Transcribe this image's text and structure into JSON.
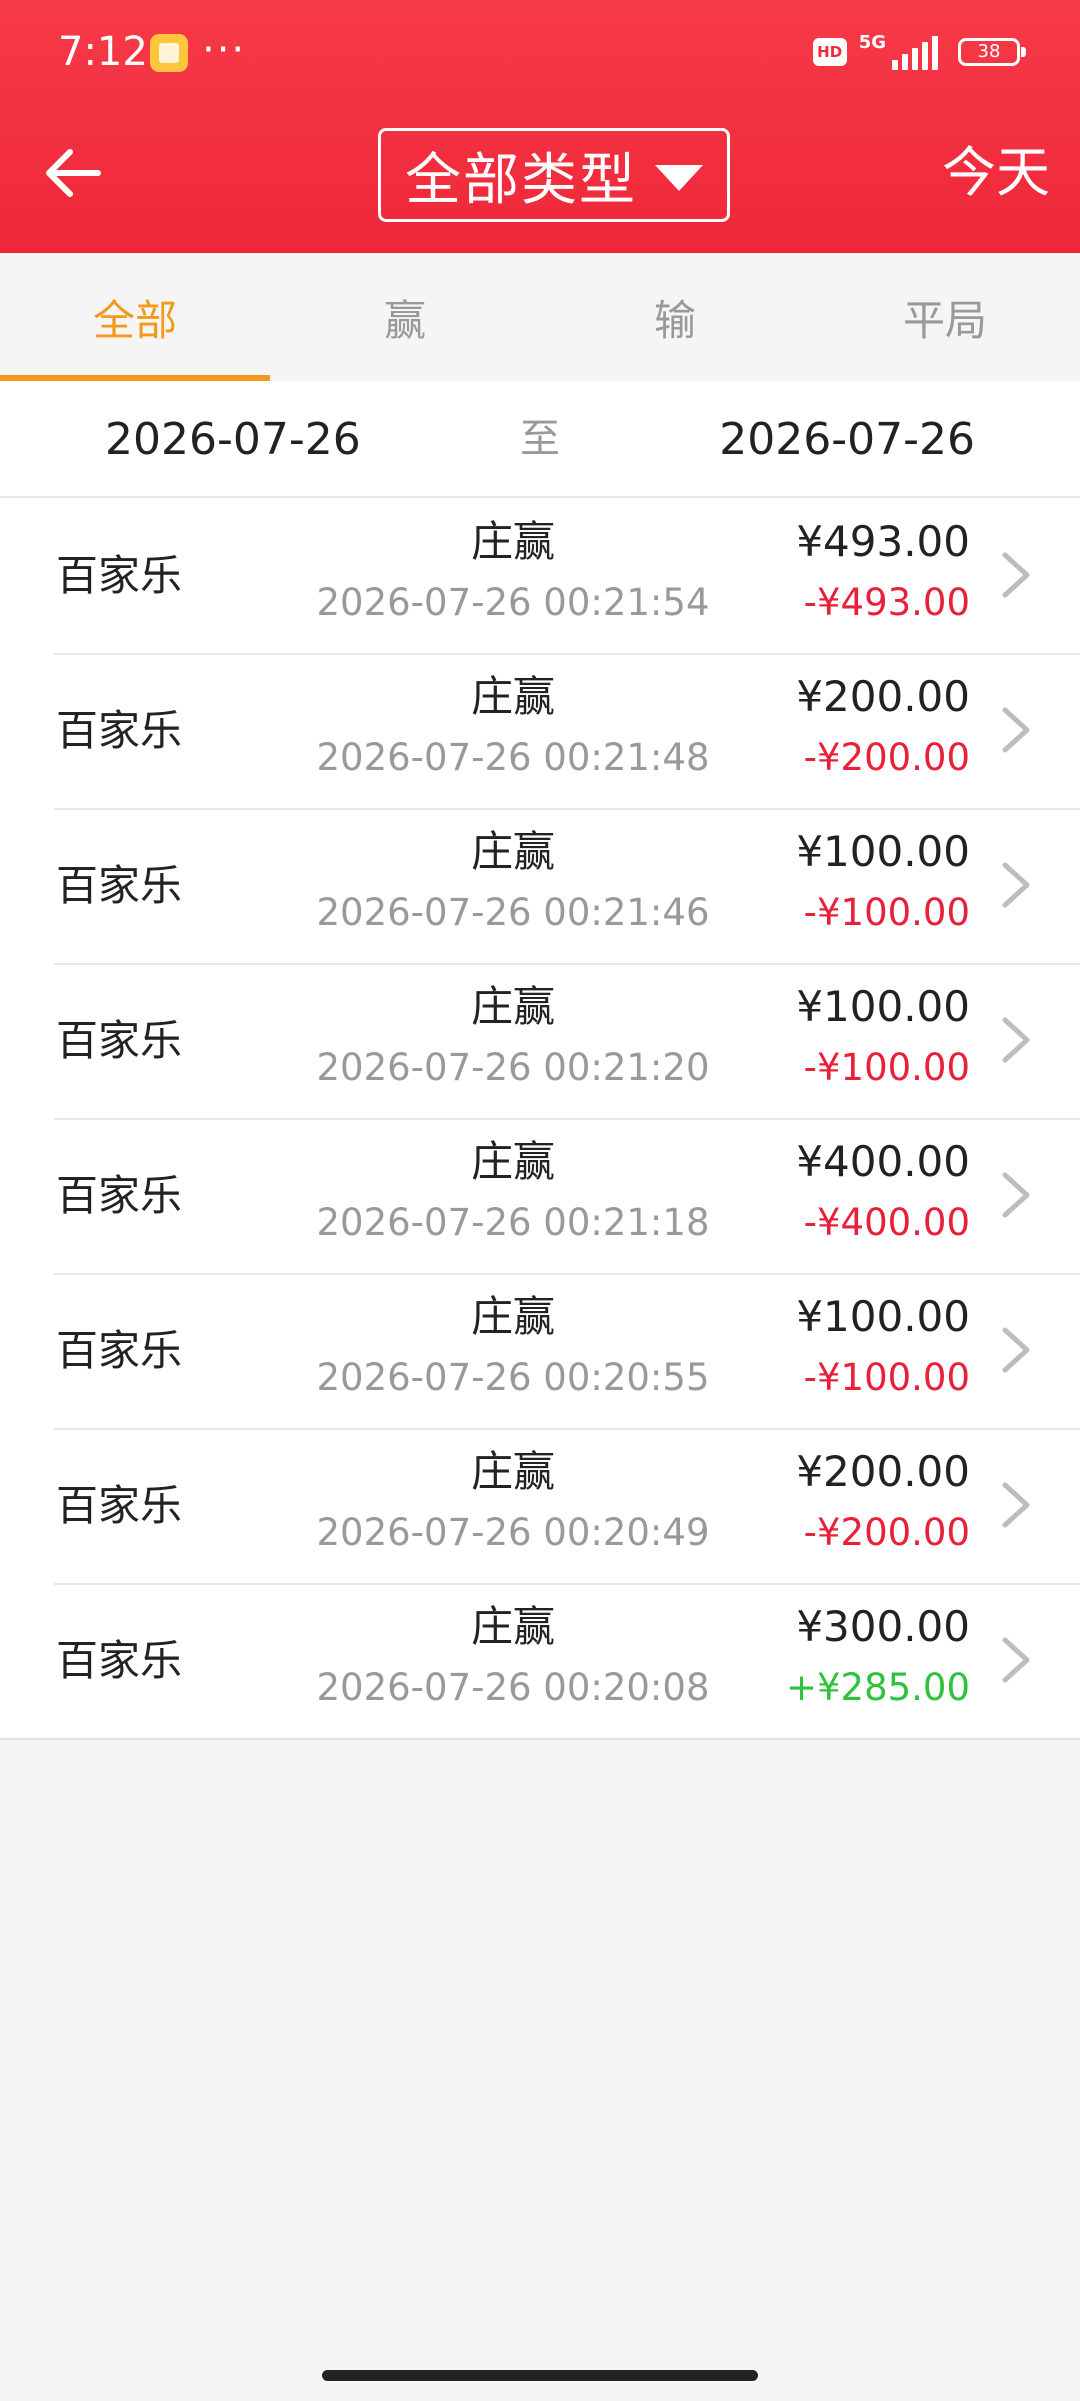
{
  "status_bar": {
    "time": "7:12",
    "dots": "···",
    "hd": "HD",
    "network": "5G",
    "battery": "38"
  },
  "header": {
    "back_icon": "arrow-left-icon",
    "title": "全部类型",
    "title_icon": "caret-down-icon",
    "today_label": "今天"
  },
  "tabs": [
    {
      "label": "全部",
      "active": true
    },
    {
      "label": "赢",
      "active": false
    },
    {
      "label": "输",
      "active": false
    },
    {
      "label": "平局",
      "active": false
    }
  ],
  "date_range": {
    "from": "2026-07-26",
    "separator": "至",
    "to": "2026-07-26"
  },
  "records": [
    {
      "game": "百家乐",
      "result": "庄赢",
      "time": "2026-07-26 00:21:54",
      "bet": "¥493.00",
      "profit": "-¥493.00",
      "profit_type": "loss"
    },
    {
      "game": "百家乐",
      "result": "庄赢",
      "time": "2026-07-26 00:21:48",
      "bet": "¥200.00",
      "profit": "-¥200.00",
      "profit_type": "loss"
    },
    {
      "game": "百家乐",
      "result": "庄赢",
      "time": "2026-07-26 00:21:46",
      "bet": "¥100.00",
      "profit": "-¥100.00",
      "profit_type": "loss"
    },
    {
      "game": "百家乐",
      "result": "庄赢",
      "time": "2026-07-26 00:21:20",
      "bet": "¥100.00",
      "profit": "-¥100.00",
      "profit_type": "loss"
    },
    {
      "game": "百家乐",
      "result": "庄赢",
      "time": "2026-07-26 00:21:18",
      "bet": "¥400.00",
      "profit": "-¥400.00",
      "profit_type": "loss"
    },
    {
      "game": "百家乐",
      "result": "庄赢",
      "time": "2026-07-26 00:20:55",
      "bet": "¥100.00",
      "profit": "-¥100.00",
      "profit_type": "loss"
    },
    {
      "game": "百家乐",
      "result": "庄赢",
      "time": "2026-07-26 00:20:49",
      "bet": "¥200.00",
      "profit": "-¥200.00",
      "profit_type": "loss"
    },
    {
      "game": "百家乐",
      "result": "庄赢",
      "time": "2026-07-26 00:20:08",
      "bet": "¥300.00",
      "profit": "+¥285.00",
      "profit_type": "win"
    }
  ],
  "colors": {
    "header": "#f0303f",
    "tab_active": "#f39a1e",
    "loss": "#e8203a",
    "win": "#2fc23d"
  }
}
